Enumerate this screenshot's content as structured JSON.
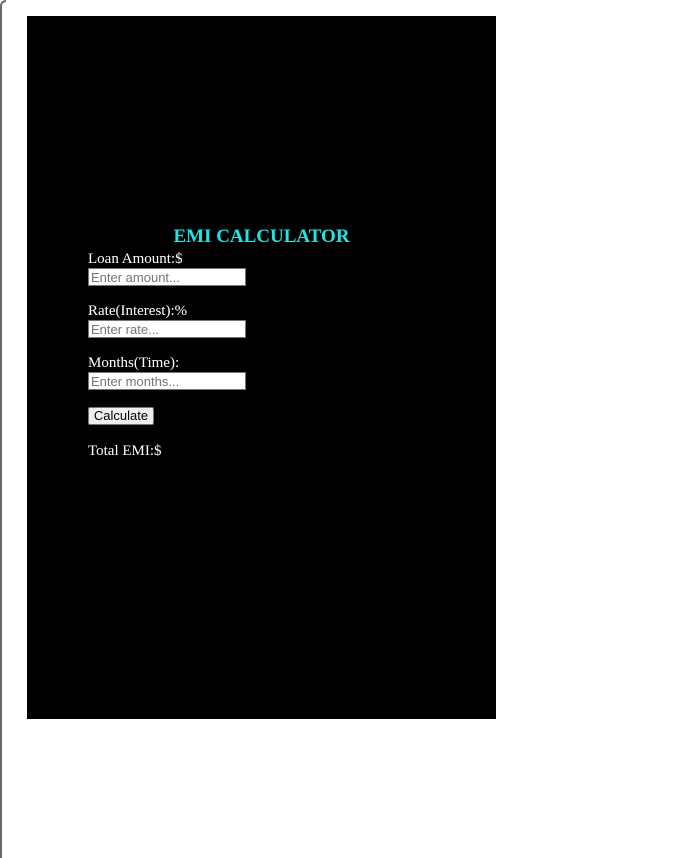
{
  "app": {
    "title": "EMI CALCULATOR"
  },
  "form": {
    "loan_amount": {
      "label": "Loan Amount:$",
      "value": "",
      "placeholder": "Enter amount..."
    },
    "rate": {
      "label": "Rate(Interest):%",
      "value": "",
      "placeholder": "Enter rate..."
    },
    "months": {
      "label": "Months(Time):",
      "value": "",
      "placeholder": "Enter months..."
    },
    "calculate_label": "Calculate"
  },
  "result": {
    "label": "Total EMI:$",
    "value": ""
  },
  "colors": {
    "page_background": "#ffffff",
    "panel_background": "#000000",
    "title_color": "#1ee6e6",
    "text_color": "#ffffff"
  }
}
